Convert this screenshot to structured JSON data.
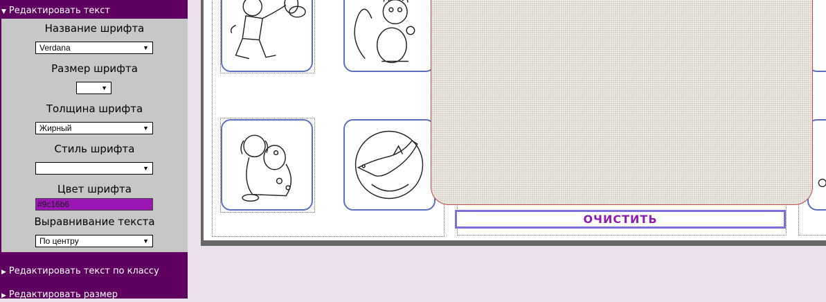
{
  "panel": {
    "header": "Редактировать текст",
    "font_name_label": "Название шрифта",
    "font_name_value": "Verdana",
    "font_size_label": "Размер шрифта",
    "font_size_value": "",
    "font_weight_label": "Толщина шрифта",
    "font_weight_value": "Жирный",
    "font_style_label": "Стиль шрифта",
    "font_style_value": "",
    "font_color_label": "Цвет шрифта",
    "font_color_value": "#9c16b6",
    "align_label": "Выравнивание текста",
    "align_value": "По центру",
    "nav_class": "Редактировать текст по классу",
    "nav_size": "Редактировать размер"
  },
  "main": {
    "clear_button": "ОЧИСТИТЬ"
  },
  "colors": {
    "panel_bg": "#5f0060",
    "panel_body": "#c7c7c7",
    "page_bg": "#ebe0ec",
    "accent": "#9c16b6",
    "thumb_border": "#5a6fc0"
  },
  "icons": [
    "triangle-down-icon",
    "triangle-right-icon",
    "dropdown-arrow-icon"
  ]
}
